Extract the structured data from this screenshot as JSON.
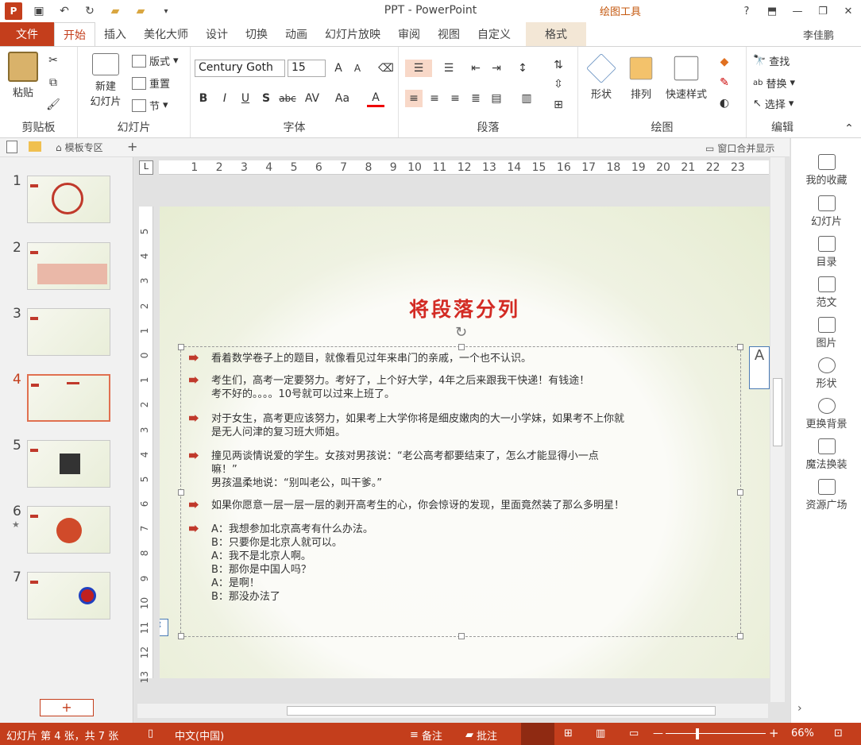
{
  "app": {
    "title": "PPT - PowerPoint",
    "contextual_tab_group": "绘图工具",
    "user": "李佳鹏",
    "accent": "#c43e1c"
  },
  "qat": [
    "powerpoint-icon",
    "save-icon",
    "undo-icon",
    "redo-icon",
    "open-folder-icon",
    "folder-icon",
    "customize-icon"
  ],
  "tabs": [
    {
      "label": "文件",
      "kind": "file"
    },
    {
      "label": "开始",
      "kind": "active"
    },
    {
      "label": "插入"
    },
    {
      "label": "美化大师"
    },
    {
      "label": "设计"
    },
    {
      "label": "切换"
    },
    {
      "label": "动画"
    },
    {
      "label": "幻灯片放映"
    },
    {
      "label": "审阅"
    },
    {
      "label": "视图"
    },
    {
      "label": "自定义"
    },
    {
      "label": "格式",
      "kind": "context"
    }
  ],
  "ribbon": {
    "clipboard": {
      "label": "剪贴板",
      "paste": "粘贴"
    },
    "slides": {
      "label": "幻灯片",
      "new_slide_1": "新建",
      "new_slide_2": "幻灯片",
      "layout": "版式",
      "reset": "重置",
      "section": "节"
    },
    "font": {
      "label": "字体",
      "family": "Century Goth",
      "size": "15",
      "bold": "B",
      "italic": "I",
      "underline": "U",
      "shadow": "S",
      "strike": "abc",
      "spacing": "AV",
      "case": "Aa",
      "color": "A",
      "grow": "A",
      "shrink": "A"
    },
    "paragraph": {
      "label": "段落"
    },
    "drawing": {
      "label": "绘图",
      "shapes": "形状",
      "arrange": "排列",
      "quick_styles": "快速样式"
    },
    "editing": {
      "label": "编辑",
      "find": "查找",
      "replace": "替换",
      "select": "选择"
    }
  },
  "subbar": {
    "template_zone": "模板专区",
    "merge_windows": "窗口合并显示",
    "add": "+"
  },
  "thumbnails": [
    {
      "num": "1"
    },
    {
      "num": "2"
    },
    {
      "num": "3"
    },
    {
      "num": "4",
      "selected": true
    },
    {
      "num": "5"
    },
    {
      "num": "6",
      "star": "★"
    },
    {
      "num": "7"
    }
  ],
  "add_slide": "+",
  "ruler_h": [
    "1",
    "2",
    "3",
    "4",
    "5",
    "6",
    "7",
    "8",
    "9",
    "10",
    "11",
    "12",
    "13",
    "14",
    "15",
    "16",
    "17",
    "18",
    "19",
    "20",
    "21",
    "22",
    "23"
  ],
  "ruler_v": [
    "5",
    "4",
    "3",
    "2",
    "1",
    "0",
    "1",
    "2",
    "3",
    "4",
    "5",
    "6",
    "7",
    "8",
    "9",
    "10",
    "11",
    "12",
    "13"
  ],
  "slide": {
    "title": "将段落分列",
    "bullets": [
      {
        "text": "看着数学卷子上的题目，就像看见过年来串门的亲戚，一个也不认识。"
      },
      {
        "text": "考生们，高考一定要努力。考好了，上个好大学，4年之后来跟我干快递！有钱途！\n考不好的。。。。10号就可以过来上班了。"
      },
      {
        "text": "对于女生，高考更应该努力，如果考上大学你将是细皮嫩肉的大一小学妹，如果考不上你就\n是无人问津的复习班大师姐。"
      },
      {
        "text": "撞见两谈情说爱的学生。女孩对男孩说：“老公高考都要结束了，怎么才能显得小一点\n嘛！”\n男孩温柔地说：“别叫老公，叫干爹。”"
      },
      {
        "text": "如果你愿意一层一层一层的剥开高考生的心，你会惊讶的发现，里面竟然装了那么多明星！"
      },
      {
        "text": "A：我想参加北京高考有什么办法。\nB：只要你是北京人就可以。\nA：我不是北京人啊。\nB：那你是中国人吗？\nA：是啊！\nB：那没办法了"
      }
    ]
  },
  "side_panel": [
    "我的收藏",
    "幻灯片",
    "目录",
    "范文",
    "图片",
    "形状",
    "更换背景",
    "魔法换装",
    "资源广场"
  ],
  "status": {
    "slide_info": "幻灯片 第 4 张，共 7 张",
    "language": "中文(中国)",
    "notes": "备注",
    "comments": "批注",
    "zoom": "66%"
  }
}
